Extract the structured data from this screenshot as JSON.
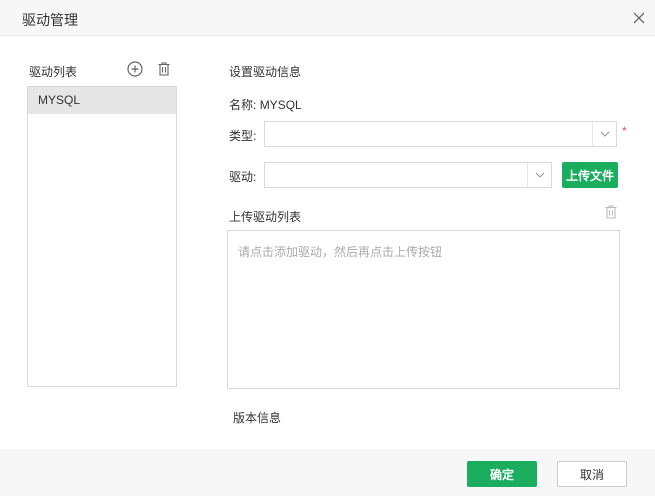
{
  "dialog": {
    "title": "驱动管理",
    "close_icon": "close-icon"
  },
  "left_panel": {
    "title": "驱动列表",
    "add_icon": "add-circle-icon",
    "delete_icon": "trash-icon",
    "items": [
      {
        "label": "MYSQL",
        "selected": true
      }
    ]
  },
  "right_panel": {
    "title": "设置驱动信息",
    "name_label": "名称:",
    "name_value": "MYSQL",
    "type_label": "类型:",
    "type_value": "",
    "required_mark": "*",
    "driver_label": "驱动:",
    "driver_value": "",
    "upload_button": "上传文件",
    "upload_list_title": "上传驱动列表",
    "upload_placeholder": "请点击添加驱动，然后再点击上传按钮",
    "version_label": "版本信息"
  },
  "footer": {
    "ok_label": "确定",
    "cancel_label": "取消"
  },
  "colors": {
    "accent": "#1aad5e",
    "required": "#e84e4e",
    "selected_bg": "#e6e6e6",
    "header_bg": "#f7f7f7"
  }
}
